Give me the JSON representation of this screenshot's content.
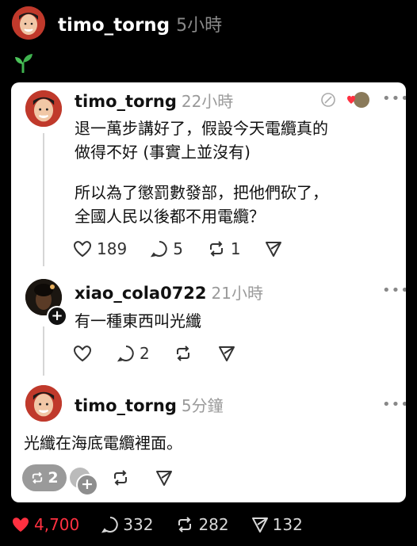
{
  "header": {
    "username": "timo_torng",
    "time": "5小時"
  },
  "seedling_icon": "seedling",
  "posts": [
    {
      "username": "timo_torng",
      "time": "22小時",
      "text1": "退一萬步講好了，假設今天電纜真的\n做得不好 (事實上並沒有)",
      "text2": "所以為了懲罰數發部，把他們砍了，\n全國人民以後都不用電纜？",
      "likes": "189",
      "replies": "5",
      "reposts": "1"
    },
    {
      "username": "xiao_cola0722",
      "time": "21小時",
      "text": "有一種東西叫光纖",
      "replies": "2"
    },
    {
      "username": "timo_torng",
      "time": "5分鐘",
      "text": "光纖在海底電纜裡面。",
      "repost_count": "2"
    }
  ],
  "footer": {
    "likes": "4,700",
    "replies": "332",
    "reposts": "282",
    "shares": "132"
  },
  "colors": {
    "like_red": "#ff3040",
    "background": "#000000",
    "card": "#ffffff"
  }
}
